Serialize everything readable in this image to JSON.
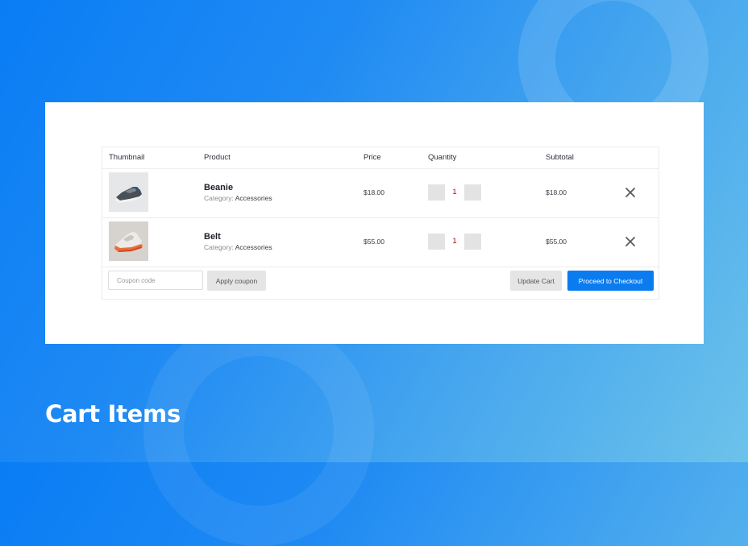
{
  "page": {
    "heading": "Cart Items"
  },
  "cart": {
    "columns": {
      "thumbnail": "Thumbnail",
      "product": "Product",
      "price": "Price",
      "quantity": "Quantity",
      "subtotal": "Subtotal"
    },
    "items": [
      {
        "name": "Beanie",
        "category_label": "Category:",
        "category": "Accessories",
        "price": "$18.00",
        "quantity": "1",
        "subtotal": "$18.00",
        "thumbnail_icon": "sneaker-gray-image"
      },
      {
        "name": "Belt",
        "category_label": "Category:",
        "category": "Accessories",
        "price": "$55.00",
        "quantity": "1",
        "subtotal": "$55.00",
        "thumbnail_icon": "sneaker-orange-image"
      }
    ],
    "coupon": {
      "placeholder": "Coupon code",
      "apply_label": "Apply coupon"
    },
    "update_label": "Update Cart",
    "checkout_label": "Proceed to Checkout"
  },
  "colors": {
    "accent": "#0a7cf0",
    "background_start": "#0a7df5",
    "background_end": "#6cc2ea"
  }
}
